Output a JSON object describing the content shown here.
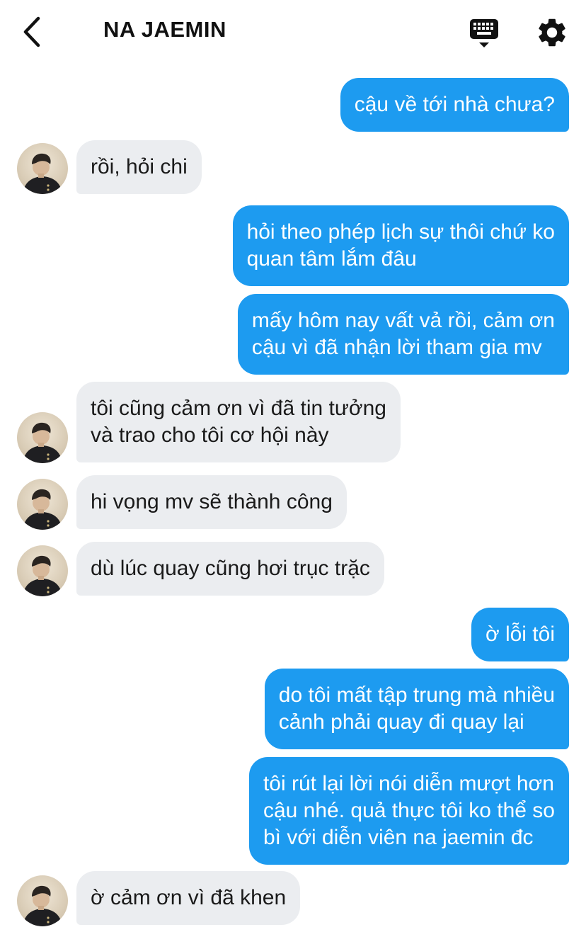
{
  "header": {
    "title": "NA JAEMIN",
    "icons": [
      "chevron-left-icon",
      "keyboard-icon",
      "gear-icon"
    ]
  },
  "colors": {
    "outgoing_bubble": "#1d9bf0",
    "incoming_bubble": "#ebedf0"
  },
  "messages": [
    {
      "side": "outgoing",
      "text": "cậu về tới nhà chưa?"
    },
    {
      "side": "incoming",
      "text": "rồi, hỏi chi"
    },
    {
      "side": "outgoing",
      "text": "hỏi theo phép lịch sự thôi chứ ko\nquan tâm lắm đâu"
    },
    {
      "side": "outgoing",
      "text": "mấy hôm nay vất vả rồi, cảm ơn\ncậu vì đã nhận lời tham gia mv"
    },
    {
      "side": "incoming",
      "text": "tôi cũng cảm ơn vì đã tin tưởng\nvà trao cho tôi cơ hội này"
    },
    {
      "side": "incoming",
      "text": "hi vọng mv sẽ thành công"
    },
    {
      "side": "incoming",
      "text": "dù lúc quay cũng hơi trục trặc"
    },
    {
      "side": "outgoing",
      "text": "ờ lỗi tôi"
    },
    {
      "side": "outgoing",
      "text": "do tôi mất tập trung mà nhiều\ncảnh phải quay đi quay lại"
    },
    {
      "side": "outgoing",
      "text": "tôi rút lại lời nói diễn mượt hơn\ncậu nhé. quả thực tôi ko thể so\nbì với diễn viên na jaemin đc"
    },
    {
      "side": "incoming",
      "text": "ờ cảm ơn vì đã khen"
    }
  ]
}
